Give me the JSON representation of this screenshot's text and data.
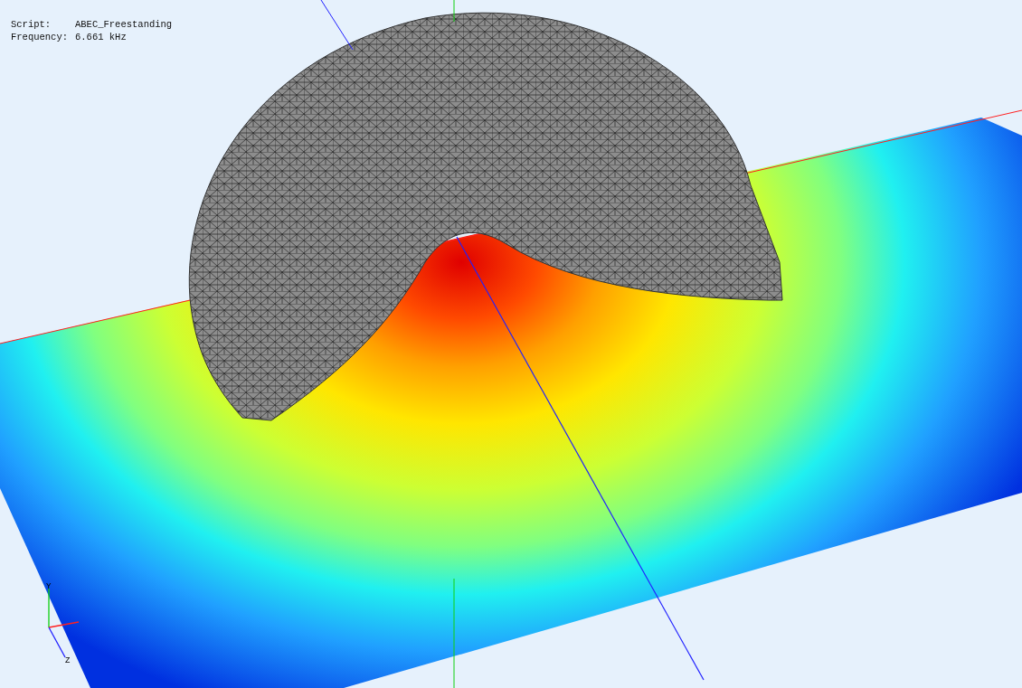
{
  "info": [
    {
      "label": "Script:",
      "value": "ABEC_Freestanding"
    },
    {
      "label": "Frequency:",
      "value": "6.661 kHz"
    }
  ],
  "triad": {
    "y_label": "Y",
    "z_label": "Z"
  }
}
